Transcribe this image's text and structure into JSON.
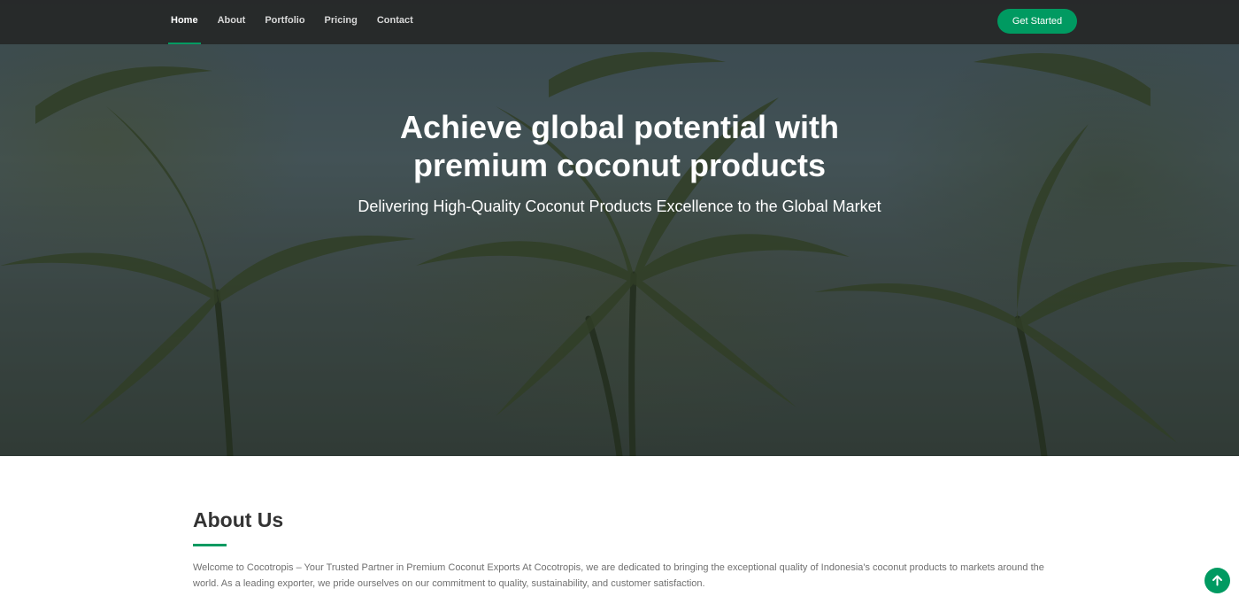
{
  "nav": {
    "items": [
      {
        "label": "Home",
        "active": true
      },
      {
        "label": "About",
        "active": false
      },
      {
        "label": "Portfolio",
        "active": false
      },
      {
        "label": "Pricing",
        "active": false
      },
      {
        "label": "Contact",
        "active": false
      }
    ],
    "cta_label": "Get Started"
  },
  "hero": {
    "title_line1": "Achieve global potential with",
    "title_line2": "premium coconut products",
    "subtitle": "Delivering High-Quality Coconut Products Excellence to the Global Market"
  },
  "about": {
    "title": "About Us",
    "text": "Welcome to Cocotropis – Your Trusted Partner in Premium Coconut Exports At Cocotropis, we are dedicated to bringing the exceptional quality of Indonesia's coconut products to markets around the world. As a leading exporter, we pride ourselves on our commitment to quality, sustainability, and customer satisfaction."
  },
  "back_to_top": {
    "icon": "arrow-up-icon"
  },
  "colors": {
    "accent": "#009a61",
    "nav_bg": "#262828",
    "heading": "#333333",
    "body_text": "#707070"
  }
}
